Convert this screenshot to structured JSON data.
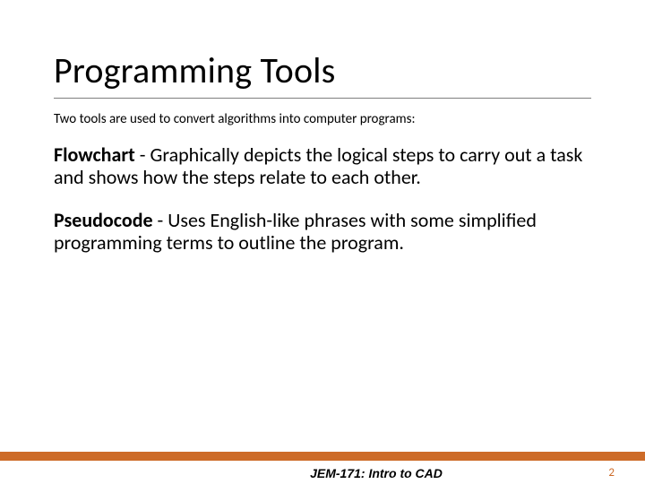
{
  "title": "Programming Tools",
  "subtitle": "Two tools are used to convert algorithms into computer programs:",
  "items": [
    {
      "term": "Flowchart",
      "desc": " - Graphically depicts the logical steps to carry out a task and shows how the steps relate to each other."
    },
    {
      "term": "Pseudocode",
      "desc": " - Uses English-like phrases with some simplified programming terms to outline the program."
    }
  ],
  "footer": "JEM-171: Intro to CAD",
  "page": "2"
}
